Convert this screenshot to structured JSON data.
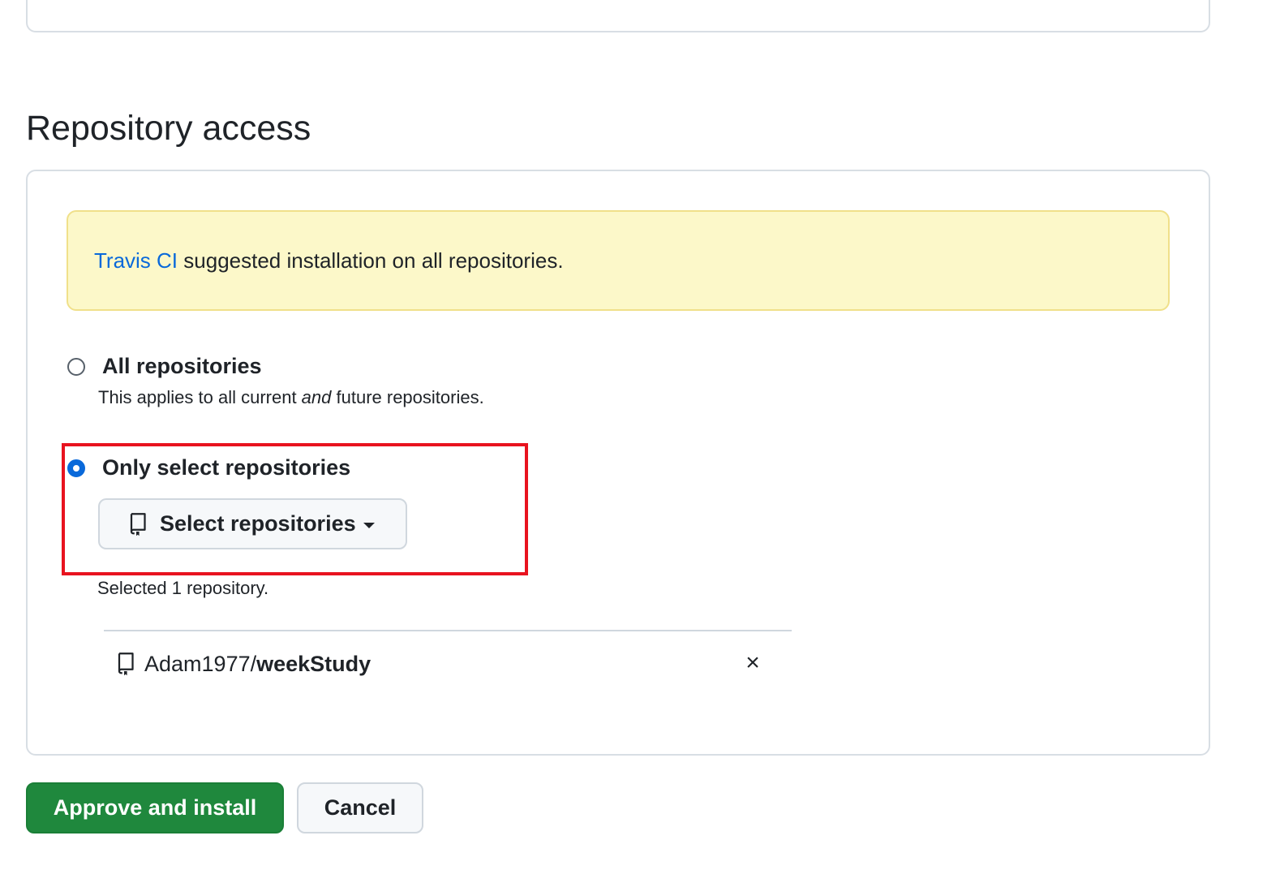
{
  "section": {
    "title": "Repository access"
  },
  "flash": {
    "app_name": "Travis CI",
    "message": " suggested installation on all repositories."
  },
  "options": {
    "all": {
      "label": "All repositories",
      "desc_prefix": "This applies to all current ",
      "desc_emphasis": "and",
      "desc_suffix": " future repositories.",
      "selected": false
    },
    "select": {
      "label": "Only select repositories",
      "selected": true,
      "button_label": "Select repositories"
    }
  },
  "selection": {
    "count_text": "Selected 1 repository.",
    "repos": [
      {
        "owner": "Adam1977/",
        "name": "weekStudy"
      }
    ],
    "remove_symbol": "×"
  },
  "actions": {
    "approve_label": "Approve and install",
    "cancel_label": "Cancel"
  },
  "colors": {
    "primary_green": "#1f883d",
    "link_blue": "#0969da",
    "flash_bg": "#fcf8c9",
    "highlight_red": "#e8131f"
  },
  "icons": {
    "repo": "repo-icon",
    "caret": "caret-down-icon",
    "remove": "close-icon"
  }
}
